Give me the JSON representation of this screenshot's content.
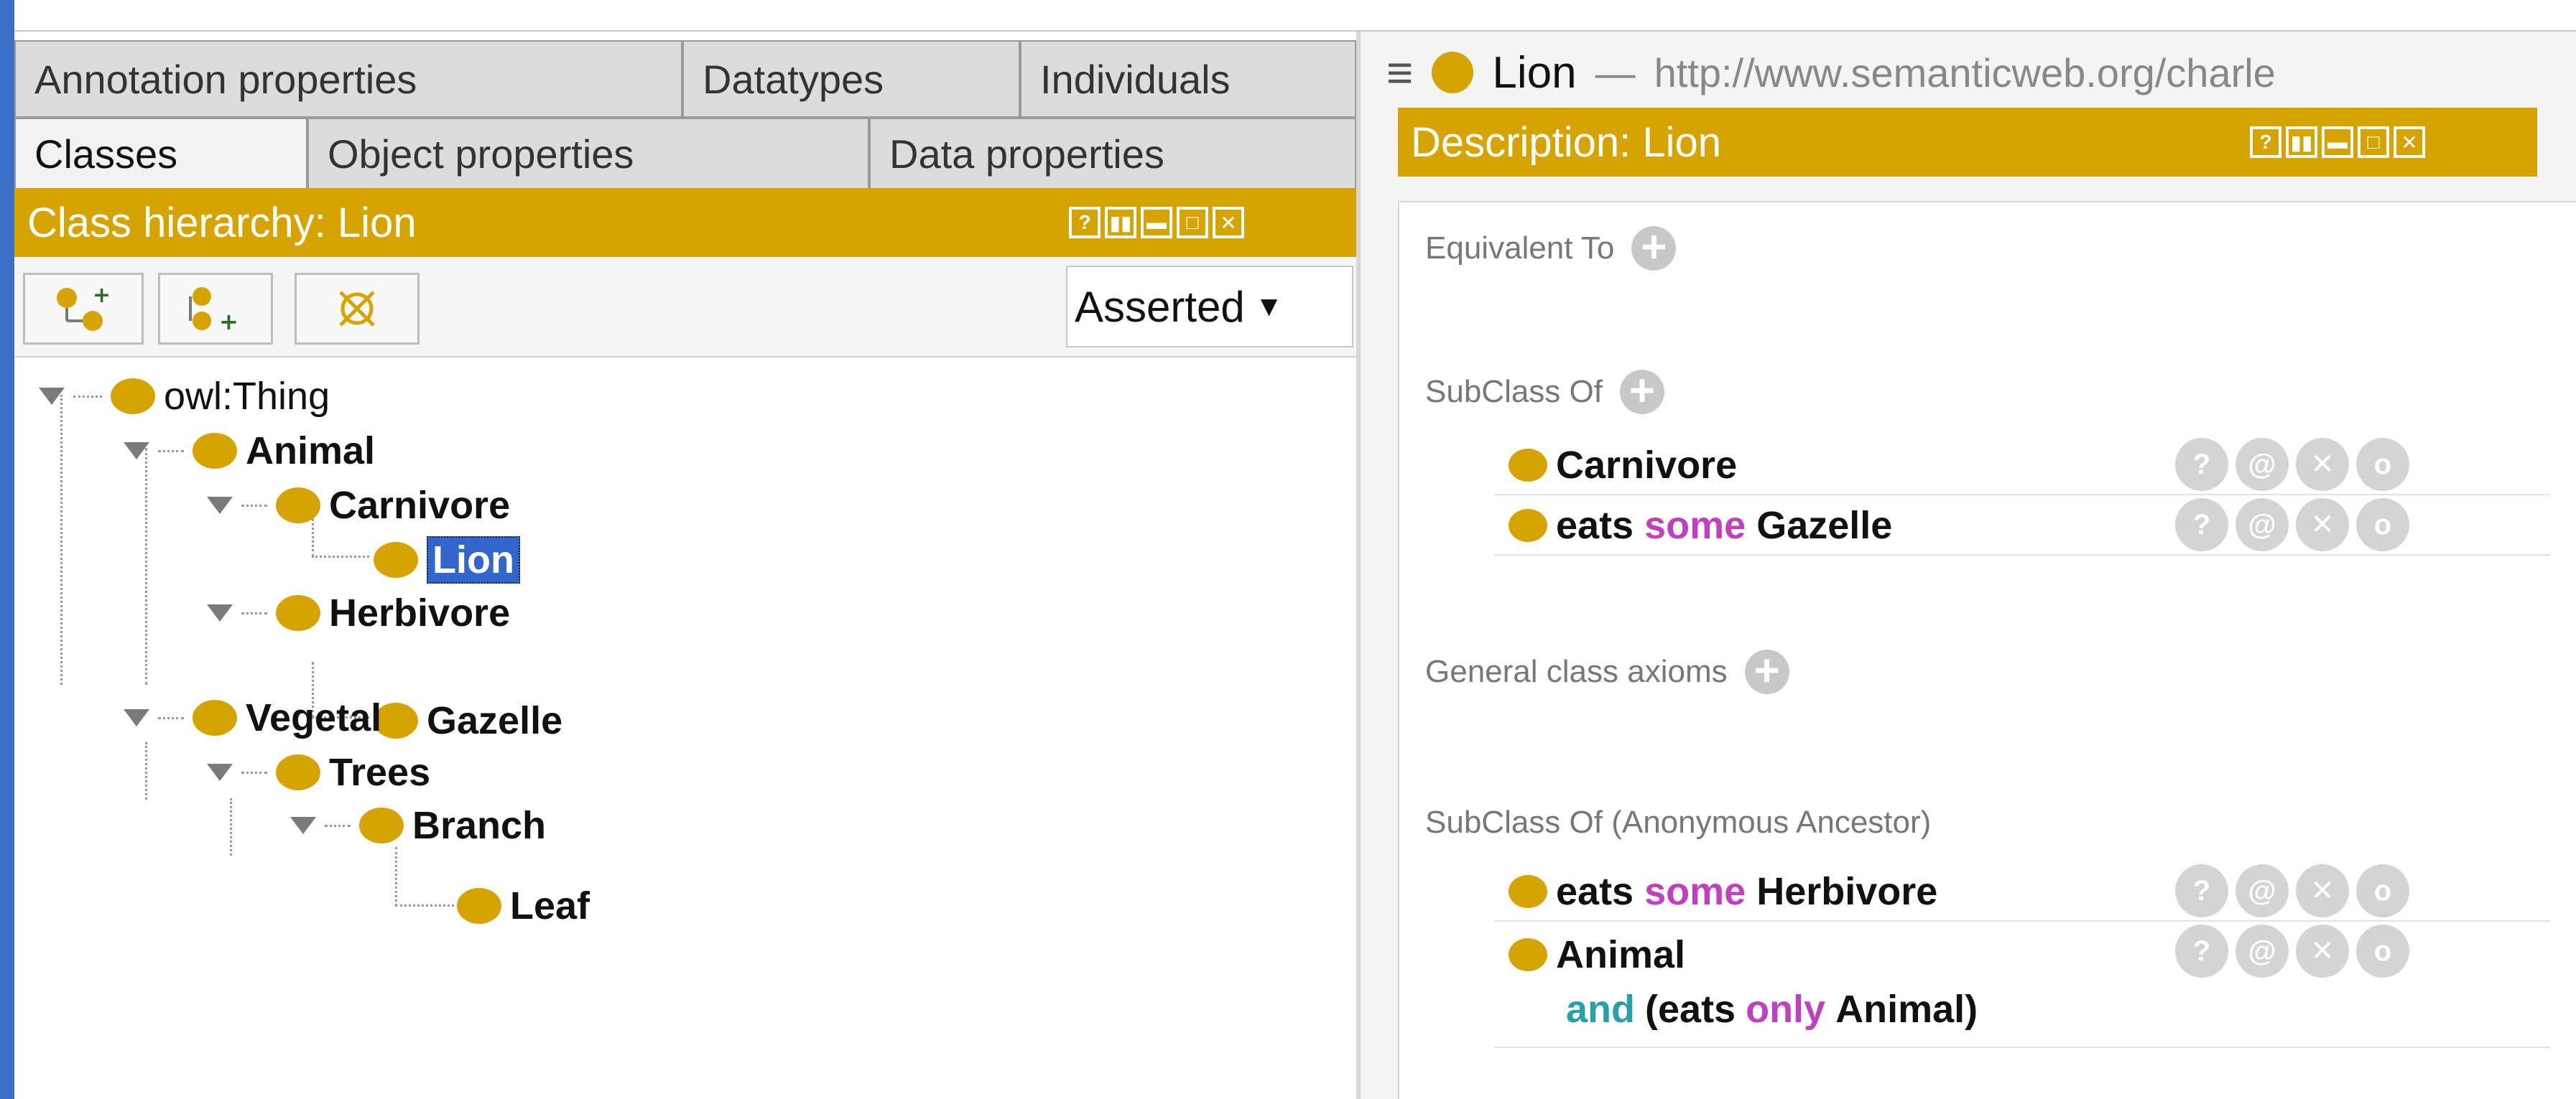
{
  "tabs_row1": [
    "Annotation properties",
    "Datatypes",
    "Individuals"
  ],
  "tabs_row2": [
    "Classes",
    "Object properties",
    "Data properties"
  ],
  "active_tab": "Classes",
  "class_hierarchy": {
    "title": "Class hierarchy: Lion",
    "dropdown_value": "Asserted",
    "tree": [
      {
        "label": "owl:Thing"
      },
      {
        "label": "Animal"
      },
      {
        "label": "Carnivore"
      },
      {
        "label": "Lion",
        "selected": true
      },
      {
        "label": "Herbivore"
      },
      {
        "label": "Gazelle"
      },
      {
        "label": "Vegetal"
      },
      {
        "label": "Trees"
      },
      {
        "label": "Branch"
      },
      {
        "label": "Leaf"
      }
    ]
  },
  "entity_header": {
    "name": "Lion",
    "dash": "—",
    "iri": "http://www.semanticweb.org/charle"
  },
  "description": {
    "title": "Description: Lion",
    "equivalent_to": "Equivalent To",
    "subclass_of": "SubClass Of",
    "subclass_items": [
      {
        "parts": [
          "Carnivore"
        ]
      },
      {
        "parts": [
          "eats",
          "some",
          "Gazelle"
        ]
      }
    ],
    "general_axioms": "General class axioms",
    "anon_ancestor": "SubClass Of (Anonymous Ancestor)",
    "anon_items": [
      {
        "parts": [
          "eats",
          "some",
          "Herbivore"
        ]
      },
      {
        "line1": "Animal",
        "line2": [
          "and",
          "(eats",
          "only",
          "Animal)"
        ]
      }
    ]
  },
  "window_buttons": [
    "?",
    "▮▮",
    "▬",
    "□",
    "✕"
  ],
  "row_actions": [
    "?",
    "@",
    "✕",
    "o"
  ],
  "colors": {
    "gold": "#d6a400",
    "keyword": "#c040c0",
    "and_keyword": "#28a0a8",
    "selection": "#3366cc"
  }
}
